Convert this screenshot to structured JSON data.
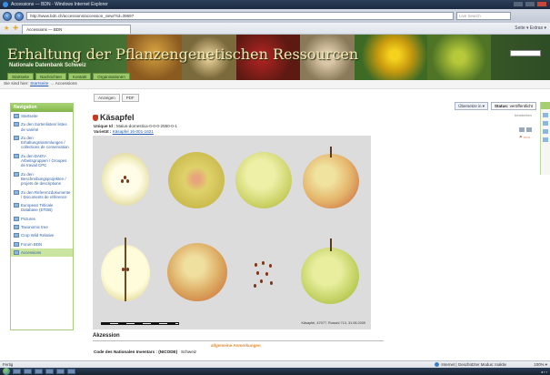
{
  "window": {
    "title": "Accessions — BDN - Windows Internet Explorer",
    "url": "http://www.bdn.ch/accessions/accession_view/?id=39697",
    "search_placeholder": "Live Search",
    "tab_title": "Accessions — BDN",
    "tools": "Seite ▾  Extras ▾"
  },
  "banner": {
    "title": "Erhaltung der Pflanzengenetischen Ressourcen",
    "subtitle": "Nationale Datenbank Schweiz",
    "nav": [
      "Startseite",
      "Nachrichten",
      "Kontakt",
      "Organisationen"
    ]
  },
  "breadcrumb": {
    "prefix": "Sie sind hier:",
    "items": [
      "Startseite",
      "Accessions"
    ],
    "separator": "→"
  },
  "sidebar": {
    "title": "Navigation",
    "items": [
      {
        "label": "Startseite",
        "icon": "home-icon",
        "active": false
      },
      {
        "label": "Zu den Sortenlisten/ listes de variété",
        "icon": "folder-icon",
        "active": false
      },
      {
        "label": "Zu den Erhaltungssammlungen / collections de conservation",
        "icon": "folder-icon",
        "active": false
      },
      {
        "label": "Zu den DADV-Arbeitsgruppen / Groupes de travail CPC",
        "icon": "folder-icon",
        "active": false
      },
      {
        "label": "Zu den Beschreibungsprojekten / projets de descriptions",
        "icon": "folder-icon",
        "active": false
      },
      {
        "label": "Zu den Referenzdokumente / Documents de référence",
        "icon": "folder-icon",
        "active": false
      },
      {
        "label": "European Triticale Database (ETDB)",
        "icon": "folder-icon",
        "active": false
      },
      {
        "label": "Pictures",
        "icon": "folder-icon",
        "active": false
      },
      {
        "label": "Taxonomic tree",
        "icon": "folder-icon",
        "active": false
      },
      {
        "label": "Crop Wild Relative",
        "icon": "folder-icon",
        "active": false
      },
      {
        "label": "Forum BDN",
        "icon": "forum-icon",
        "active": false
      },
      {
        "label": "Accessions",
        "icon": "folder-icon",
        "active": true
      }
    ]
  },
  "content": {
    "subtabs": [
      "Anzeigen",
      "PDF"
    ],
    "translate_label": "Übersetze in ▾",
    "status_label": "Status:",
    "status_value": "veröffentlicht",
    "edit_label": "bearbeiten",
    "title": "Käsapfel",
    "unique_id_label": "Unique Id :",
    "unique_id_value": "Malus-domestica-0-0-0-2550-0-1",
    "variety_label": "Varietät :",
    "variety_value": "Käsapfel 16-001-1621",
    "photo_credit": "Käsapfel, 47077, Rossini 713, 31.08.2009",
    "section_title": "Akzession",
    "general_remarks": "allgemeine Anmerkungen",
    "row_label": "Code des Nationalen Inventars : (NICODE)",
    "row_value": "Schweiz"
  },
  "statusbar": {
    "left": "Fertig",
    "zone": "Internet | Geschützter Modus: Inaktiv",
    "zoom": "100% ▾"
  },
  "colors": {
    "nav_green": "#82b54a",
    "link_blue": "#245bb5",
    "accent_orange": "#e08b2c"
  }
}
